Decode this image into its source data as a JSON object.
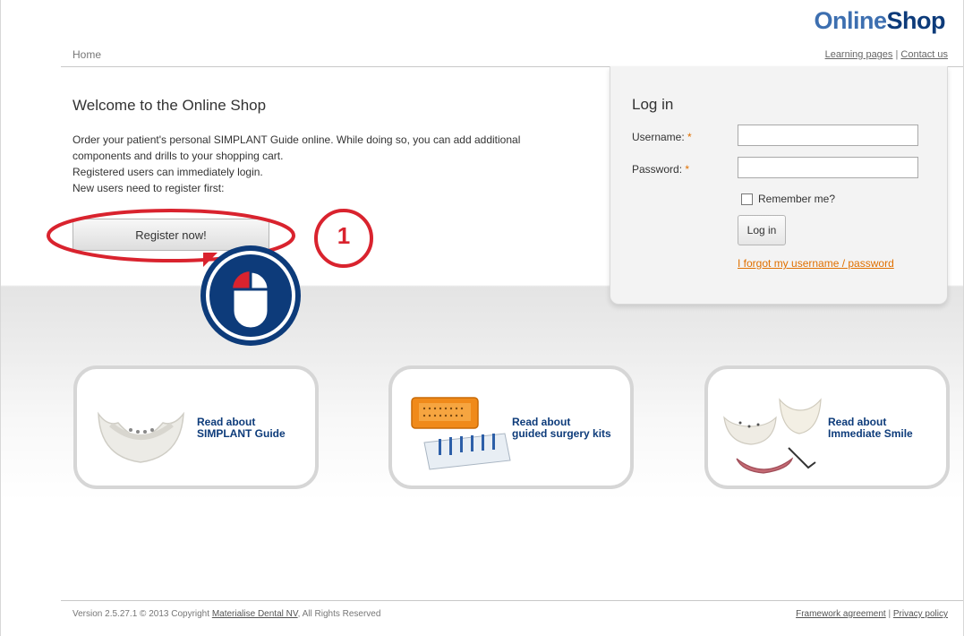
{
  "brand": {
    "part1": "Online",
    "part2": "Shop"
  },
  "nav": {
    "home": "Home",
    "learning_pages": "Learning pages",
    "separator": "|",
    "contact_us": "Contact us"
  },
  "welcome": {
    "title": "Welcome to the Online Shop",
    "lines": [
      "Order your patient's personal SIMPLANT Guide online. While doing so, you can add additional",
      "components and drills to your shopping cart.",
      "Registered users can immediately login.",
      "New users need to register first:"
    ],
    "register_label": "Register now!"
  },
  "callout": {
    "step": "1"
  },
  "login": {
    "title": "Log in",
    "username_label": "Username:",
    "password_label": "Password:",
    "required_mark": "*",
    "username_value": "",
    "password_value": "",
    "remember_label": "Remember me?",
    "button_label": "Log in",
    "forgot_label": "I forgot my username / password"
  },
  "cards": [
    {
      "line1": "Read about",
      "line2": "SIMPLANT Guide"
    },
    {
      "line1": "Read about",
      "line2": "guided surgery kits"
    },
    {
      "line1": "Read about",
      "line2": "Immediate Smile"
    }
  ],
  "footer": {
    "version_prefix": "Version 2.5.27.1 © 2013 Copyright",
    "company": "Materialise Dental NV",
    "rights": ", All Rights Reserved",
    "framework": "Framework agreement",
    "separator": "|",
    "privacy": "Privacy policy"
  },
  "colors": {
    "brand_light": "#3d6fb0",
    "brand_dark": "#0d3b7a",
    "link_orange": "#e07000",
    "callout_red": "#d9232e"
  }
}
